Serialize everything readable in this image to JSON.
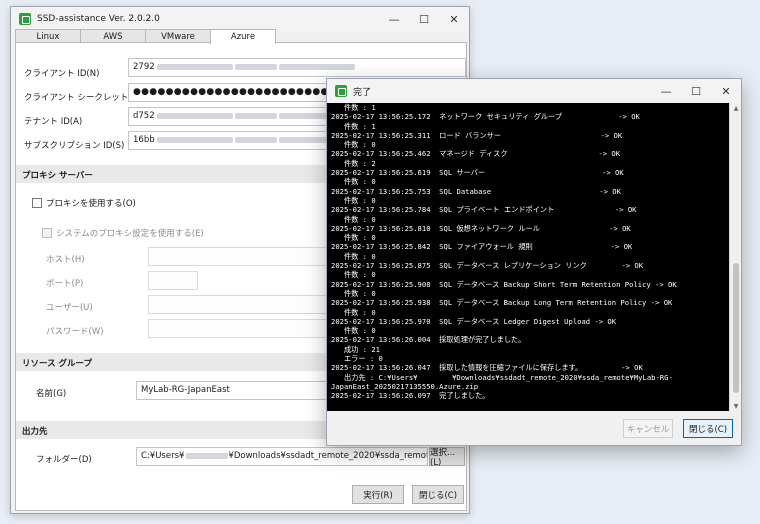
{
  "main_window": {
    "title": "SSD-assistance Ver. 2.0.2.0",
    "tabs": [
      {
        "label": "Linux"
      },
      {
        "label": "AWS"
      },
      {
        "label": "VMware"
      },
      {
        "label": "Azure"
      }
    ],
    "client_id": {
      "label": "クライアント ID(N)",
      "value": "2792"
    },
    "client_secret": {
      "label": "クライアント シークレット(I)",
      "value": "●●●●●●●●●●●●●●●●●●●●●●●●●●●●●●●●●●●●●●●●"
    },
    "tenant_id": {
      "label": "テナント ID(A)",
      "value": "d752"
    },
    "subscription_id": {
      "label": "サブスクリプション ID(S)",
      "value": "16bb"
    },
    "proxy_section": "プロキシ サーバー",
    "use_proxy": "プロキシを使用する(O)",
    "use_system_proxy": "システムのプロキシ設定を使用する(E)",
    "host_label": "ホスト(H)",
    "port_label": "ポート(P)",
    "user_label": "ユーザー(U)",
    "password_label": "パスワード(W)",
    "resource_group_section": "リソース グループ",
    "name_label": "名前(G)",
    "name_value": "MyLab-RG-JapanEast",
    "output_section": "出力先",
    "folder_label": "フォルダー(D)",
    "folder_value_prefix": "C:¥Users¥",
    "folder_value_suffix": "¥Downloads¥ssdadt_remote_2020¥ssda_remote¥",
    "browse_button": "選択...(L)",
    "run_button": "実行(R)",
    "close_button": "閉じる(C)"
  },
  "done_window": {
    "title": "完了",
    "lines": [
      "   件数 : 1",
      "2025-02-17 13:56:25.172  ネットワーク セキュリティ グループ             -> OK",
      "   件数 : 1",
      "2025-02-17 13:56:25.311  ロード バランサー                       -> OK",
      "   件数 : 0",
      "2025-02-17 13:56:25.462  マネージド ディスク                     -> OK",
      "   件数 : 2",
      "2025-02-17 13:56:25.619  SQL サーバー                           -> OK",
      "   件数 : 0",
      "2025-02-17 13:56:25.753  SQL Database                         -> OK",
      "   件数 : 0",
      "2025-02-17 13:56:25.784  SQL プライベート エンドポイント              -> OK",
      "   件数 : 0",
      "2025-02-17 13:56:25.810  SQL 仮想ネットワーク ルール                -> OK",
      "   件数 : 0",
      "2025-02-17 13:56:25.842  SQL ファイアウォール 規則                  -> OK",
      "   件数 : 0",
      "2025-02-17 13:56:25.875  SQL データベース レプリケーション リンク        -> OK",
      "   件数 : 0",
      "2025-02-17 13:56:25.908  SQL データベース Backup Short Term Retention Policy -> OK",
      "   件数 : 0",
      "2025-02-17 13:56:25.938  SQL データベース Backup Long Term Retention Policy -> OK",
      "   件数 : 0",
      "2025-02-17 13:56:25.970  SQL データベース Ledger Digest Upload -> OK",
      "   件数 : 0",
      "2025-02-17 13:56:26.004  採取処理が完了しました。",
      "   成功 : 21",
      "   エラー : 0",
      "2025-02-17 13:56:26.047  採取した情報を圧縮ファイルに保存します。         -> OK",
      "   出力先 : C:¥Users¥        ¥Downloads¥ssdadt_remote_2020¥ssda_remote¥MyLab-RG-",
      "JapanEast_20250217135550.Azure.zip",
      "2025-02-17 13:56:26.097  完了しました。"
    ],
    "cancel_button": "キャンセル",
    "close_button": "閉じる(C)"
  },
  "colors": {
    "accent": "#0067c0",
    "console_bg": "#000000",
    "app_icon": "#2e9e3e"
  }
}
